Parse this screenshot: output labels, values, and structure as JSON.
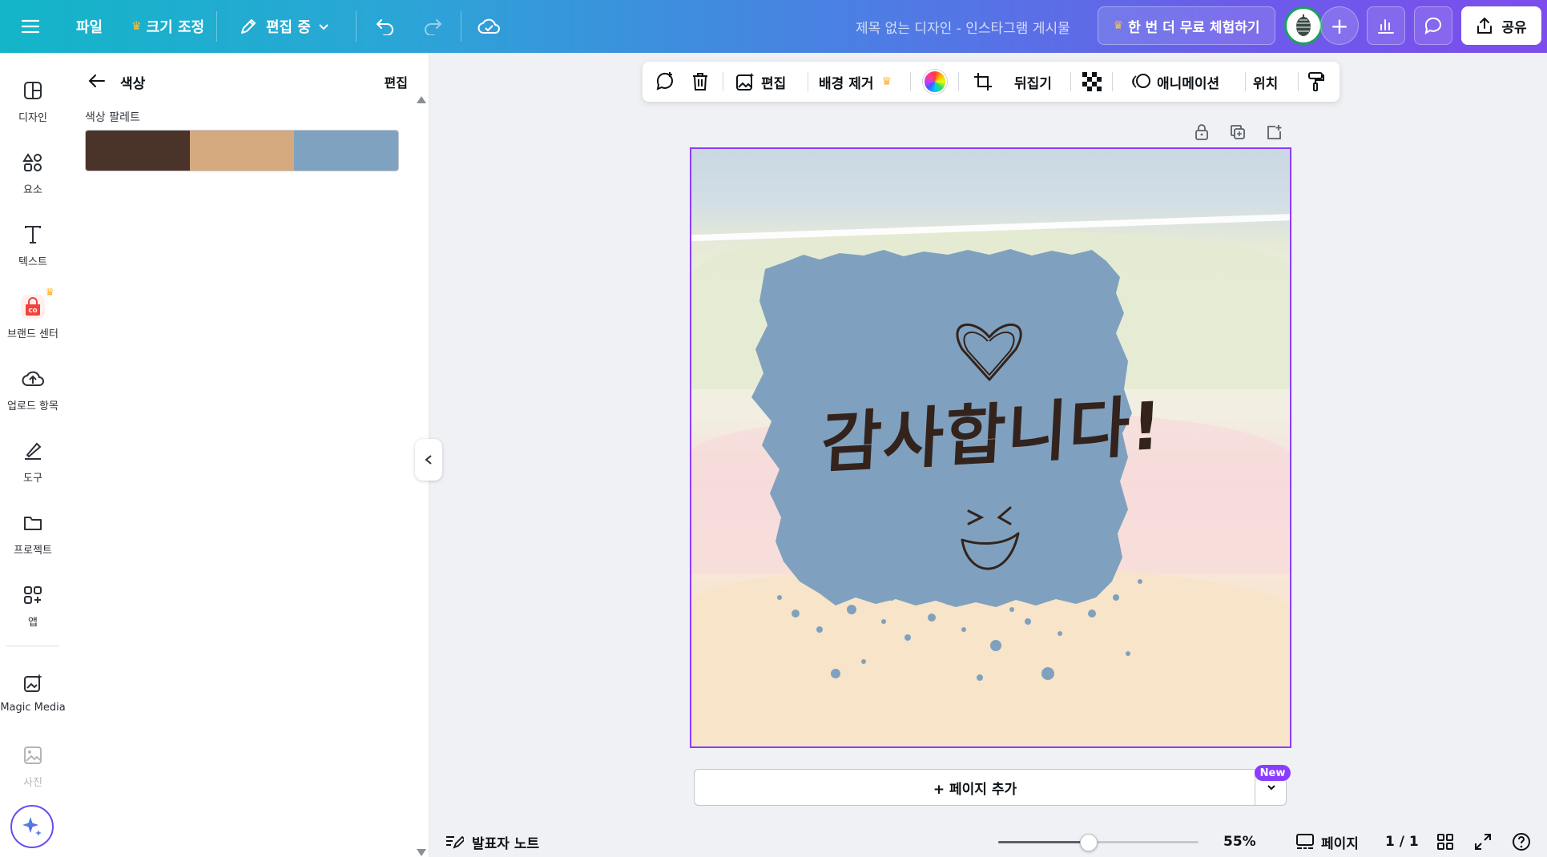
{
  "topbar": {
    "file": "파일",
    "resize": "크기 조정",
    "editing": "편집 중",
    "title": "제목 없는 디자인 - 인스타그램 게시물",
    "trial": "한 번 더 무료 체험하기",
    "share": "공유"
  },
  "rail": {
    "items": [
      {
        "label": "디자인",
        "icon": "design-icon"
      },
      {
        "label": "요소",
        "icon": "elements-icon"
      },
      {
        "label": "텍스트",
        "icon": "text-icon"
      },
      {
        "label": "브랜드 센터",
        "icon": "brand-icon"
      },
      {
        "label": "업로드 항목",
        "icon": "upload-icon"
      },
      {
        "label": "도구",
        "icon": "tools-icon"
      },
      {
        "label": "프로젝트",
        "icon": "folder-icon"
      },
      {
        "label": "앱",
        "icon": "apps-icon"
      },
      {
        "label": "Magic Media",
        "icon": "magic-media-icon"
      },
      {
        "label": "사진",
        "icon": "photo-icon"
      }
    ]
  },
  "panel": {
    "title": "색상",
    "edit": "편집",
    "palette_label": "색상 팔레트",
    "swatches": [
      "#4a3329",
      "#d4a97e",
      "#7ea2c0"
    ]
  },
  "context_toolbar": {
    "edit": "편집",
    "bg_remove": "배경 제거",
    "flip": "뒤집기",
    "animate": "애니메이션",
    "position": "위치"
  },
  "design": {
    "text": "감사합니다!",
    "blob_color": "#7fa1bf",
    "frame_color": "#8b3dff"
  },
  "add_page": {
    "label": "+ 페이지 추가",
    "badge": "New"
  },
  "bottom": {
    "notes": "발표자 노트",
    "zoom": "55%",
    "zoom_fraction": 0.45,
    "pages_label": "페이지",
    "page_count": "1 / 1"
  }
}
